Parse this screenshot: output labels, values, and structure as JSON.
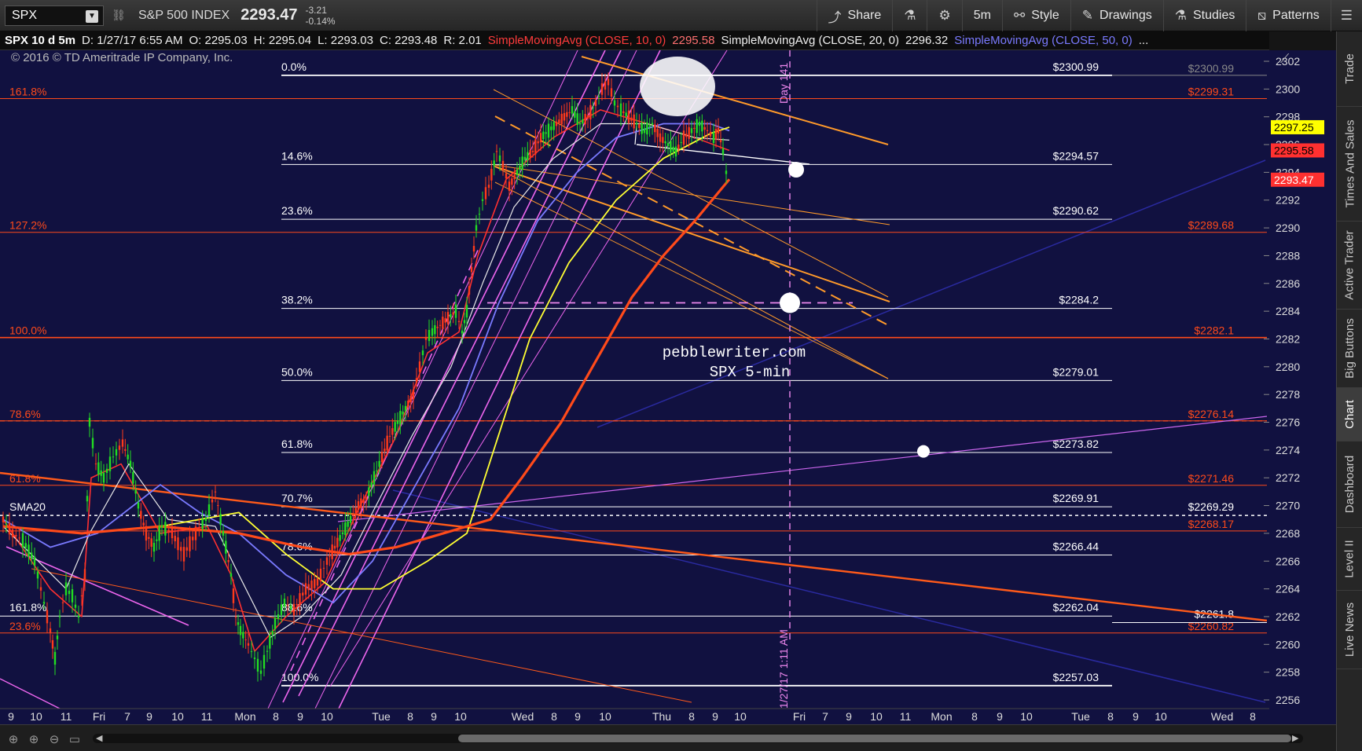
{
  "toolbar": {
    "symbol": "SPX",
    "index_name": "S&P 500 INDEX",
    "last_price": "2293.47",
    "change": "-3.21",
    "change_pct": "-0.14%",
    "share_label": "Share",
    "timeframe_label": "5m",
    "style_label": "Style",
    "drawings_label": "Drawings",
    "studies_label": "Studies",
    "patterns_label": "Patterns"
  },
  "infobar": {
    "title": "SPX 10 d 5m",
    "date": "D: 1/27/17 6:55 AM",
    "open": "O: 2295.03",
    "high": "H: 2295.04",
    "low": "L: 2293.03",
    "close": "C: 2293.48",
    "range": "R: 2.01",
    "sma10_label": "SimpleMovingAvg (CLOSE, 10, 0)",
    "sma10_value": "2295.58",
    "sma20_label": "SimpleMovingAvg (CLOSE, 20, 0)",
    "sma20_value": "2296.32",
    "sma50_label": "SimpleMovingAvg (CLOSE, 50, 0)",
    "ellipsis": "..."
  },
  "side_tabs": [
    "Trade",
    "Times And Sales",
    "Active Trader",
    "Big Buttons",
    "Chart",
    "Dashboard",
    "Level II",
    "Live News"
  ],
  "chart_data": {
    "type": "line",
    "copyright": "© 2016 © TD Ameritrade IP Company, Inc.",
    "watermark_line1": "pebblewriter.com",
    "watermark_line2": "SPX 5-min",
    "ylim": [
      2255,
      2303
    ],
    "y_ticks": [
      2256,
      2258,
      2260,
      2262,
      2264,
      2266,
      2268,
      2270,
      2272,
      2274,
      2276,
      2278,
      2280,
      2282,
      2284,
      2286,
      2288,
      2290,
      2292,
      2294,
      2296,
      2298,
      2300,
      2302
    ],
    "x_labels": [
      "9",
      "10",
      "11",
      "Fri",
      "7",
      "9",
      "10",
      "11",
      "Mon",
      "8",
      "9",
      "10",
      "Tue",
      "8",
      "9",
      "10",
      "Wed",
      "8",
      "9",
      "10",
      "Thu",
      "8",
      "9",
      "10",
      "Fri",
      "7",
      "9",
      "10",
      "11",
      "Mon",
      "8",
      "9",
      "10",
      "Tue",
      "8",
      "9",
      "10",
      "Wed",
      "8"
    ],
    "fib_levels": [
      {
        "label": "0.0%",
        "price": 2300.99,
        "value_label": "$2300.99"
      },
      {
        "label": "14.6%",
        "price": 2294.57,
        "value_label": "$2294.57"
      },
      {
        "label": "23.6%",
        "price": 2290.62,
        "value_label": "$2290.62"
      },
      {
        "label": "38.2%",
        "price": 2284.2,
        "value_label": "$2284.2"
      },
      {
        "label": "50.0%",
        "price": 2279.01,
        "value_label": "$2279.01"
      },
      {
        "label": "61.8%",
        "price": 2273.82,
        "value_label": "$2273.82"
      },
      {
        "label": "70.7%",
        "price": 2269.91,
        "value_label": "$2269.91"
      },
      {
        "label": "78.6%",
        "price": 2266.44,
        "value_label": "$2266.44"
      },
      {
        "label": "88.6%",
        "price": 2262.04,
        "value_label": "$2262.04"
      },
      {
        "label": "100.0%",
        "price": 2257.03,
        "value_label": "$2257.03"
      }
    ],
    "red_levels": [
      {
        "label": "161.8%",
        "price": 2299.31,
        "value_label": "$2299.31"
      },
      {
        "label": "127.2%",
        "price": 2289.68,
        "value_label": "$2289.68"
      },
      {
        "label": "100.0%",
        "price": 2282.1,
        "value_label": "$2282.1"
      },
      {
        "label": "78.6%",
        "price": 2276.1,
        "value_label": "$2276.14"
      },
      {
        "label": "61.8%",
        "price": 2271.46,
        "value_label": "$2271.46"
      },
      {
        "label": "",
        "price": 2268.17,
        "value_label": "$2268.17"
      },
      {
        "label": "23.6%",
        "price": 2260.82,
        "value_label": "$2260.82"
      }
    ],
    "extra_labels": {
      "sma20_label": "SMA20",
      "sma20_level": "$2269.29",
      "left_fib_161": "161.8%",
      "level_2261": "$2261.8",
      "day_label": "Day 141",
      "date_label": "1/27/17 1:11 AM"
    },
    "price_tags": [
      {
        "value": "2297.25",
        "color": "#ffff00",
        "text_color": "#000000"
      },
      {
        "value": "2295.58",
        "color": "#ff3030",
        "text_color": "#000000"
      },
      {
        "value": "2293.47",
        "color": "#ff3030",
        "text_color": "#ffffff"
      }
    ],
    "price_series": [
      [
        0,
        2269
      ],
      [
        12,
        2268
      ],
      [
        25,
        2267.5
      ],
      [
        40,
        2266
      ],
      [
        52,
        2263
      ],
      [
        60,
        2261
      ],
      [
        66,
        2259
      ],
      [
        72,
        2262
      ],
      [
        80,
        2264
      ],
      [
        88,
        2263.5
      ],
      [
        96,
        2262
      ],
      [
        104,
        2265
      ],
      [
        110,
        2276
      ],
      [
        118,
        2273
      ],
      [
        128,
        2272
      ],
      [
        140,
        2273.5
      ],
      [
        152,
        2274.5
      ],
      [
        162,
        2273
      ],
      [
        172,
        2270
      ],
      [
        182,
        2268
      ],
      [
        192,
        2267
      ],
      [
        202,
        2268.5
      ],
      [
        215,
        2268
      ],
      [
        230,
        2266.5
      ],
      [
        245,
        2268
      ],
      [
        258,
        2269
      ],
      [
        270,
        2271
      ],
      [
        280,
        2268
      ],
      [
        290,
        2265
      ],
      [
        296,
        2262
      ],
      [
        302,
        2261
      ],
      [
        312,
        2260
      ],
      [
        320,
        2259
      ],
      [
        328,
        2258
      ],
      [
        336,
        2259.5
      ],
      [
        346,
        2261.5
      ],
      [
        358,
        2263
      ],
      [
        370,
        2262.5
      ],
      [
        385,
        2264
      ],
      [
        400,
        2264.5
      ],
      [
        412,
        2266
      ],
      [
        422,
        2267
      ],
      [
        432,
        2268
      ],
      [
        442,
        2269
      ],
      [
        452,
        2270
      ],
      [
        462,
        2270.5
      ],
      [
        472,
        2272
      ],
      [
        482,
        2273.5
      ],
      [
        492,
        2275
      ],
      [
        502,
        2276
      ],
      [
        512,
        2277
      ],
      [
        522,
        2278
      ],
      [
        530,
        2280
      ],
      [
        538,
        2282
      ],
      [
        546,
        2282.5
      ],
      [
        556,
        2283
      ],
      [
        566,
        2283.5
      ],
      [
        576,
        2284
      ],
      [
        584,
        2282.5
      ],
      [
        590,
        2284
      ],
      [
        596,
        2287
      ],
      [
        602,
        2290
      ],
      [
        610,
        2292
      ],
      [
        618,
        2293
      ],
      [
        628,
        2295.5
      ],
      [
        636,
        2294.5
      ],
      [
        644,
        2293
      ],
      [
        654,
        2294
      ],
      [
        664,
        2295
      ],
      [
        674,
        2295.5
      ],
      [
        684,
        2296.5
      ],
      [
        694,
        2297
      ],
      [
        704,
        2297.5
      ],
      [
        714,
        2298
      ],
      [
        724,
        2298.5
      ],
      [
        734,
        2297.5
      ],
      [
        744,
        2298
      ],
      [
        754,
        2299
      ],
      [
        762,
        2300
      ],
      [
        770,
        2300.5
      ],
      [
        778,
        2299
      ],
      [
        786,
        2298.5
      ],
      [
        796,
        2298
      ],
      [
        806,
        2297.5
      ],
      [
        816,
        2297
      ],
      [
        826,
        2297.5
      ],
      [
        836,
        2296.5
      ],
      [
        846,
        2296
      ],
      [
        856,
        2295.5
      ],
      [
        866,
        2296.5
      ],
      [
        876,
        2297
      ],
      [
        886,
        2297.5
      ],
      [
        896,
        2297
      ],
      [
        904,
        2296.5
      ],
      [
        910,
        2297
      ],
      [
        916,
        2295.5
      ],
      [
        920,
        2294
      ],
      [
        924,
        2293.47
      ]
    ],
    "sma_series": [
      {
        "name": "SimpleMovingAvg (CLOSE, 10, 0)",
        "color": "#ff3030",
        "width": 1.6,
        "values": [
          [
            0,
            2269
          ],
          [
            60,
            2264
          ],
          [
            100,
            2262
          ],
          [
            112,
            2272
          ],
          [
            150,
            2273
          ],
          [
            200,
            2268
          ],
          [
            260,
            2268.5
          ],
          [
            290,
            2265
          ],
          [
            320,
            2259.5
          ],
          [
            360,
            2262
          ],
          [
            410,
            2264.5
          ],
          [
            450,
            2269.5
          ],
          [
            500,
            2275
          ],
          [
            540,
            2281
          ],
          [
            580,
            2282.5
          ],
          [
            604,
            2288
          ],
          [
            640,
            2293.5
          ],
          [
            700,
            2296.5
          ],
          [
            760,
            2298.5
          ],
          [
            820,
            2297.5
          ],
          [
            880,
            2296.5
          ],
          [
            924,
            2295.58
          ]
        ]
      },
      {
        "name": "SimpleMovingAvg (CLOSE, 20, 0)",
        "color": "#e8e8e8",
        "width": 1.2,
        "values": [
          [
            0,
            2268.5
          ],
          [
            80,
            2264
          ],
          [
            110,
            2268
          ],
          [
            160,
            2273
          ],
          [
            210,
            2269
          ],
          [
            270,
            2268.5
          ],
          [
            300,
            2265
          ],
          [
            340,
            2260.5
          ],
          [
            380,
            2262
          ],
          [
            430,
            2265
          ],
          [
            470,
            2269.5
          ],
          [
            520,
            2275
          ],
          [
            570,
            2280
          ],
          [
            610,
            2286
          ],
          [
            650,
            2291.5
          ],
          [
            700,
            2295
          ],
          [
            760,
            2297.5
          ],
          [
            820,
            2297.5
          ],
          [
            880,
            2296.5
          ],
          [
            924,
            2296.32
          ]
        ]
      },
      {
        "name": "SimpleMovingAvg (CLOSE, 50, 0)",
        "color": "#7a7aff",
        "width": 1.8,
        "values": [
          [
            0,
            2269
          ],
          [
            60,
            2267
          ],
          [
            120,
            2268
          ],
          [
            200,
            2271.5
          ],
          [
            250,
            2269.5
          ],
          [
            300,
            2268
          ],
          [
            360,
            2265
          ],
          [
            420,
            2263
          ],
          [
            470,
            2266
          ],
          [
            530,
            2272
          ],
          [
            580,
            2277
          ],
          [
            630,
            2284.5
          ],
          [
            680,
            2290.5
          ],
          [
            730,
            2294
          ],
          [
            780,
            2296.5
          ],
          [
            840,
            2297.5
          ],
          [
            900,
            2297.5
          ],
          [
            924,
            2297
          ]
        ]
      },
      {
        "name": "SMA yellow",
        "color": "#ffff33",
        "width": 1.8,
        "values": [
          [
            0,
            2268.5
          ],
          [
            100,
            2268
          ],
          [
            200,
            2268.5
          ],
          [
            300,
            2269.5
          ],
          [
            360,
            2266.5
          ],
          [
            420,
            2264
          ],
          [
            480,
            2264
          ],
          [
            540,
            2266
          ],
          [
            590,
            2268
          ],
          [
            630,
            2275
          ],
          [
            670,
            2282
          ],
          [
            720,
            2287.5
          ],
          [
            780,
            2292
          ],
          [
            840,
            2295
          ],
          [
            900,
            2296.8
          ],
          [
            924,
            2297.25
          ]
        ]
      },
      {
        "name": "SMA red thick",
        "color": "#ff4a1a",
        "width": 3.2,
        "values": [
          [
            0,
            2268.5
          ],
          [
            100,
            2268
          ],
          [
            200,
            2268.5
          ],
          [
            300,
            2268
          ],
          [
            380,
            2267
          ],
          [
            440,
            2266.5
          ],
          [
            500,
            2267
          ],
          [
            560,
            2268
          ],
          [
            620,
            2269
          ],
          [
            660,
            2272
          ],
          [
            710,
            2276
          ],
          [
            760,
            2281
          ],
          [
            800,
            2285
          ],
          [
            840,
            2288
          ],
          [
            880,
            2290.5
          ],
          [
            924,
            2293.5
          ]
        ]
      }
    ]
  }
}
